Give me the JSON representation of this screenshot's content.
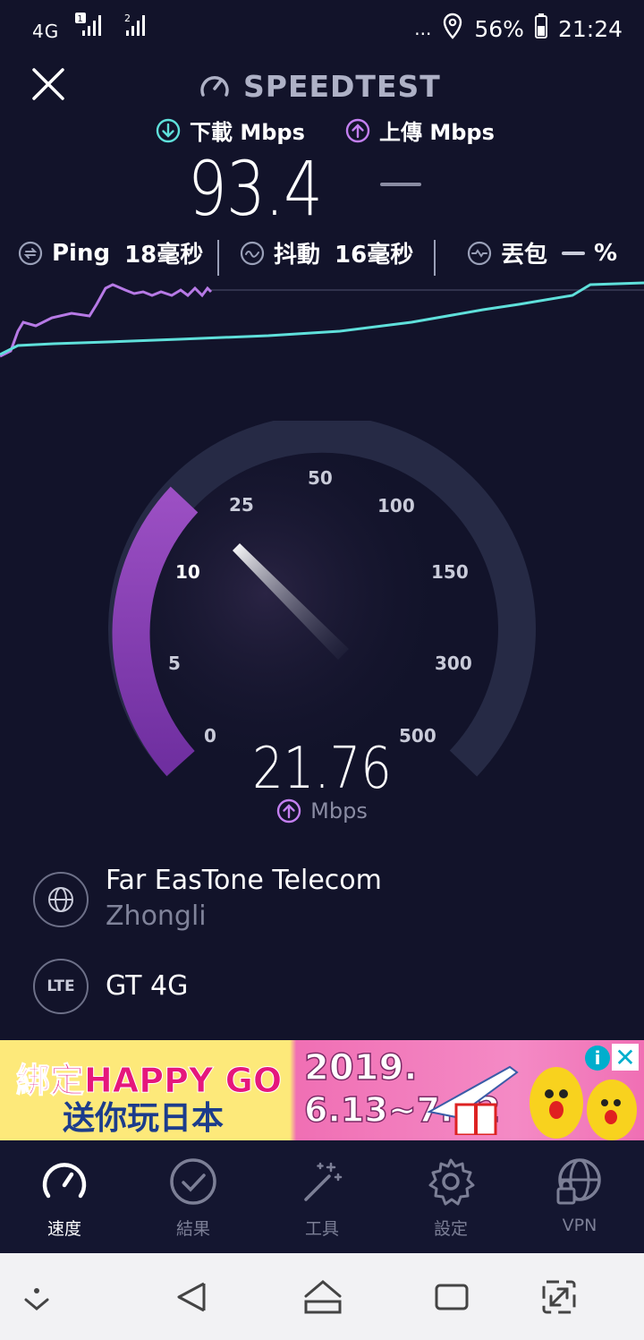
{
  "status_bar": {
    "network": "4G",
    "sim1": "1",
    "sim2": "2",
    "more": "...",
    "battery": "56%",
    "time": "21:24"
  },
  "header": {
    "title": "SPEEDTEST",
    "download_label": "下載 Mbps",
    "upload_label": "上傳 Mbps",
    "download_value": "93.4"
  },
  "metrics": {
    "ping_label": "Ping",
    "ping_value": "18毫秒",
    "jitter_label": "抖動",
    "jitter_value": "16毫秒",
    "loss_label": "丟包",
    "loss_value": "%"
  },
  "gauge": {
    "ticks": [
      "0",
      "5",
      "10",
      "25",
      "50",
      "100",
      "150",
      "300",
      "500"
    ],
    "speed": "21.76",
    "unit": "Mbps",
    "current_mbps": 21.76,
    "colors": {
      "arc_active": "#8e44ad",
      "arc_inactive": "#262a45",
      "upload": "#c37ff0",
      "download": "#5fe0db"
    }
  },
  "server": {
    "isp": "Far EasTone Telecom",
    "city": "Zhongli",
    "connection_icon_text": "LTE",
    "connection": "GT 4G"
  },
  "ad": {
    "line1": "綁定HAPPY GO",
    "line2": "送你玩日本",
    "year": "2019.",
    "dates": "6.13~7.12",
    "info": "i",
    "close": "✕"
  },
  "tabs": [
    {
      "label": "速度",
      "icon": "speed-gauge-icon",
      "active": true
    },
    {
      "label": "結果",
      "icon": "check-circle-icon",
      "active": false
    },
    {
      "label": "工具",
      "icon": "magic-wand-icon",
      "active": false
    },
    {
      "label": "設定",
      "icon": "gear-icon",
      "active": false
    },
    {
      "label": "VPN",
      "icon": "globe-lock-icon",
      "active": false
    }
  ]
}
